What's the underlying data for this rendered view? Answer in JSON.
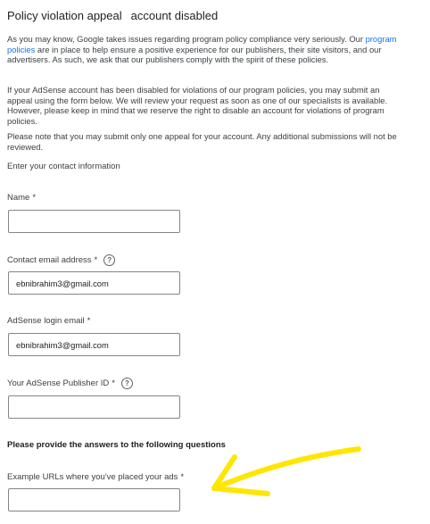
{
  "title": {
    "part1": "Policy violation appeal",
    "part2": "account disabled"
  },
  "intro": {
    "p1_before_link": "As you may know, Google takes issues regarding program policy compliance very seriously. Our ",
    "p1_link": "program policies",
    "p1_after_link": " are in place to help ensure a positive experience for our publishers, their site visitors, and our advertisers. As such, we ask that our publishers comply with the spirit of these policies.",
    "p2": "If your AdSense account has been disabled for violations of our program policies, you may submit an appeal using the form below. We will review your request as soon as one of our specialists is available. However, please keep in mind that we reserve the right to disable an account for violations of program policies.",
    "p3": "Please note that you may submit only one appeal for your account. Any additional submissions will not be reviewed."
  },
  "contact_section_label": "Enter your contact information",
  "fields": {
    "name": {
      "label": "Name",
      "required": "*",
      "value": ""
    },
    "contact_email": {
      "label": "Contact email address",
      "required": "*",
      "value": "ebnibrahim3@gmail.com"
    },
    "login_email": {
      "label": "AdSense login email",
      "required": "*",
      "value": "ebnibrahim3@gmail.com"
    },
    "publisher_id": {
      "label": "Your AdSense Publisher ID",
      "required": "*",
      "value": ""
    },
    "example_urls": {
      "label": "Example URLs where you've placed your ads",
      "required": "*",
      "value": ""
    }
  },
  "questions_heading": "Please provide the answers to the following questions",
  "help_icon_glyph": "?",
  "annotation": {
    "icon": "arrow-annotation",
    "color": "#ffe600"
  }
}
